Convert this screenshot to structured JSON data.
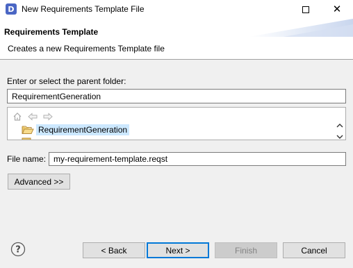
{
  "window": {
    "app_icon_letter": "D",
    "title": "New Requirements Template File",
    "maximize_icon": "maximize-icon",
    "close_icon": "close-icon"
  },
  "banner": {
    "title": "Requirements Template",
    "description": "Creates a new Requirements Template file"
  },
  "parent_folder": {
    "label": "Enter or select the parent folder:",
    "value": "RequirementGeneration"
  },
  "tree": {
    "toolbar_icons": [
      "home-icon",
      "back-arrow-icon",
      "forward-arrow-icon"
    ],
    "items": [
      {
        "label": "RequirementGeneration",
        "selected": true,
        "icon": "open-folder-icon"
      },
      {
        "label": "",
        "selected": false,
        "icon": "folder-icon"
      }
    ]
  },
  "file_name": {
    "label": "File name:",
    "value": "my-requirement-template.reqst"
  },
  "buttons": {
    "advanced": "Advanced >>",
    "back": "< Back",
    "next": "Next >",
    "finish": "Finish",
    "cancel": "Cancel",
    "help_icon": "help-icon"
  },
  "colors": {
    "selection": "#cce8ff",
    "default_button_border": "#0078d7",
    "disabled_text": "#838383"
  }
}
